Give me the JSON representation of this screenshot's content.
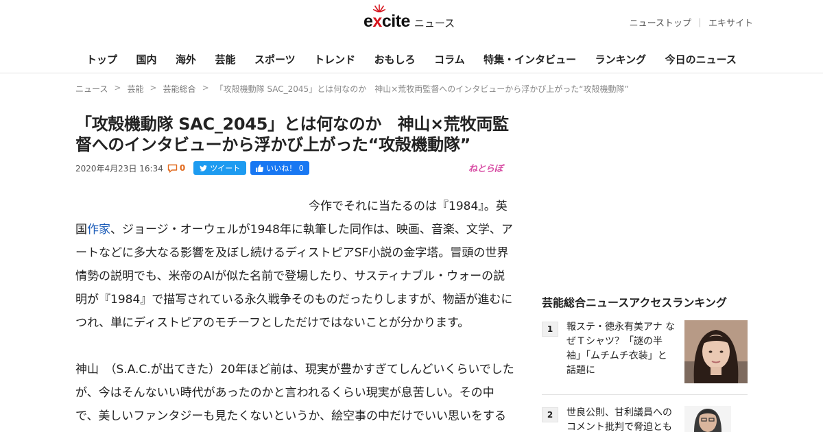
{
  "header": {
    "logo_word_pre": "e",
    "logo_word_x": "x",
    "logo_word_post": "cite",
    "logo_sub": "ニュース",
    "top_links": [
      "ニューストップ",
      "エキサイト"
    ],
    "top_sep": "｜",
    "nav": [
      "トップ",
      "国内",
      "海外",
      "芸能",
      "スポーツ",
      "トレンド",
      "おもしろ",
      "コラム",
      "特集・インタビュー",
      "ランキング",
      "今日のニュース"
    ]
  },
  "breadcrumb": {
    "items": [
      "ニュース",
      "芸能",
      "芸能総合"
    ],
    "current": "「攻殻機動隊 SAC_2045」とは何なのか　神山×荒牧両監督へのインタビューから浮かび上がった“攻殻機動隊”",
    "sep": ">"
  },
  "article": {
    "title": "「攻殻機動隊 SAC_2045」とは何なのか　神山×荒牧両監督へのインタビューから浮かび上がった“攻殻機動隊”",
    "date": "2020年4月23日 16:34",
    "comment_count": "0",
    "tweet_label": "ツイート",
    "like_label": "いいね！ 0",
    "source": "ねとらぼ",
    "p1_pre": "今作でそれに当たるのは『1984』。英国",
    "p1_link": "作家",
    "p1_post": "、ジョージ・オーウェルが1948年に執筆した同作は、映画、音楽、文学、アートなどに多大なる影響を及ぼし続けるディストピアSF小説の金字塔。冒頭の世界情勢の説明でも、米帝のAIが似た名前で登場したり、サスティナブル・ウォーの説明が『1984』で描写されている永久戦争そのものだったりしますが、物語が進むにつれ、単にディストピアのモチーフとしただけではないことが分かります。",
    "p2": "神山　（S.A.C.が出てきた）20年ほど前は、現実が豊かすぎてしんどいくらいでしたが、今はそんないい時代があったのかと言われるくらい現実が息苦しい。その中で、美しいファンタジーも見たくないというか、絵空事の中だけでいい思いをする"
  },
  "sidebar": {
    "ranking_title": "芸能総合ニュースアクセスランキング",
    "items": [
      {
        "rank": "1",
        "text": "報ステ・徳永有美アナ なぜＴシャツ？「謎の半袖」「ムチムチ衣装」と話題に"
      },
      {
        "rank": "2",
        "text": "世良公則、甘利議員へのコメント批判で脅迫とも"
      }
    ]
  },
  "colors": {
    "accent_red": "#d6141d",
    "twitter": "#1d9bf0",
    "facebook": "#1877f2",
    "link": "#1a5bb8",
    "comment": "#e16a1e"
  }
}
